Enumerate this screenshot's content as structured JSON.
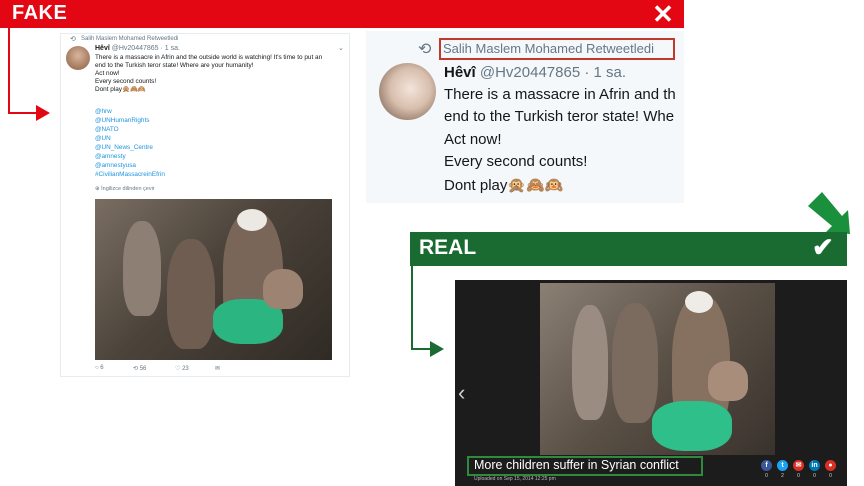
{
  "fake": {
    "label": "FAKE",
    "close_icon": "✕"
  },
  "real": {
    "label": "REAL",
    "check_icon": "✔"
  },
  "tweet_left": {
    "retweet_line": "Salih Maslem Mohamed Retweetledi",
    "display_name": "Hêvî",
    "handle": "@Hv20447865 · 1 sa.",
    "lines": [
      "There is a massacre in Afrin and the outside world is watching! It's time to put an",
      "end to the Turkish teror state! Where are your humanity!",
      "Act now!",
      "Every second counts!",
      "Dont play🙊🙈🙉"
    ],
    "links": [
      "@hrw",
      "@UNHumanRights",
      "@NATO",
      "@UN",
      "@UN_News_Centre",
      "@amnesty",
      "@amnestyusa",
      "#CivilianMassacreinEfrin"
    ],
    "translate": "İngilizce dilinden çevir",
    "actions": {
      "replies": "6",
      "retweets": "56",
      "likes": "23"
    }
  },
  "tweet_zoom": {
    "retweet_line": "Salih Maslem Mohamed Retweetledi",
    "display_name": "Hêvî",
    "handle": "@Hv20447865 · 1 sa.",
    "lines": [
      "There is a massacre in Afrin and th",
      "end to the Turkish teror state! Whe",
      "Act now!",
      "Every second counts!",
      "Dont play🙊🙈🙉"
    ]
  },
  "player": {
    "caption": "More children suffer in Syrian conflict",
    "uploaded": "Uploaded on Sep 15, 2014 12:25 pm",
    "share_buttons": [
      {
        "icon": "facebook-icon",
        "glyph": "f",
        "color": "#3b5998",
        "count": "0"
      },
      {
        "icon": "twitter-icon",
        "glyph": "t",
        "color": "#1da1f2",
        "count": "2"
      },
      {
        "icon": "email-icon",
        "glyph": "✉",
        "color": "#d93025",
        "count": "0"
      },
      {
        "icon": "linkedin-icon",
        "glyph": "in",
        "color": "#0077b5",
        "count": "0"
      },
      {
        "icon": "comment-icon",
        "glyph": "●",
        "color": "#d93025",
        "count": "0"
      }
    ]
  },
  "colors": {
    "fake_red": "#e30613",
    "real_green": "#1a6b32",
    "twitter_link": "#1b95e0"
  }
}
